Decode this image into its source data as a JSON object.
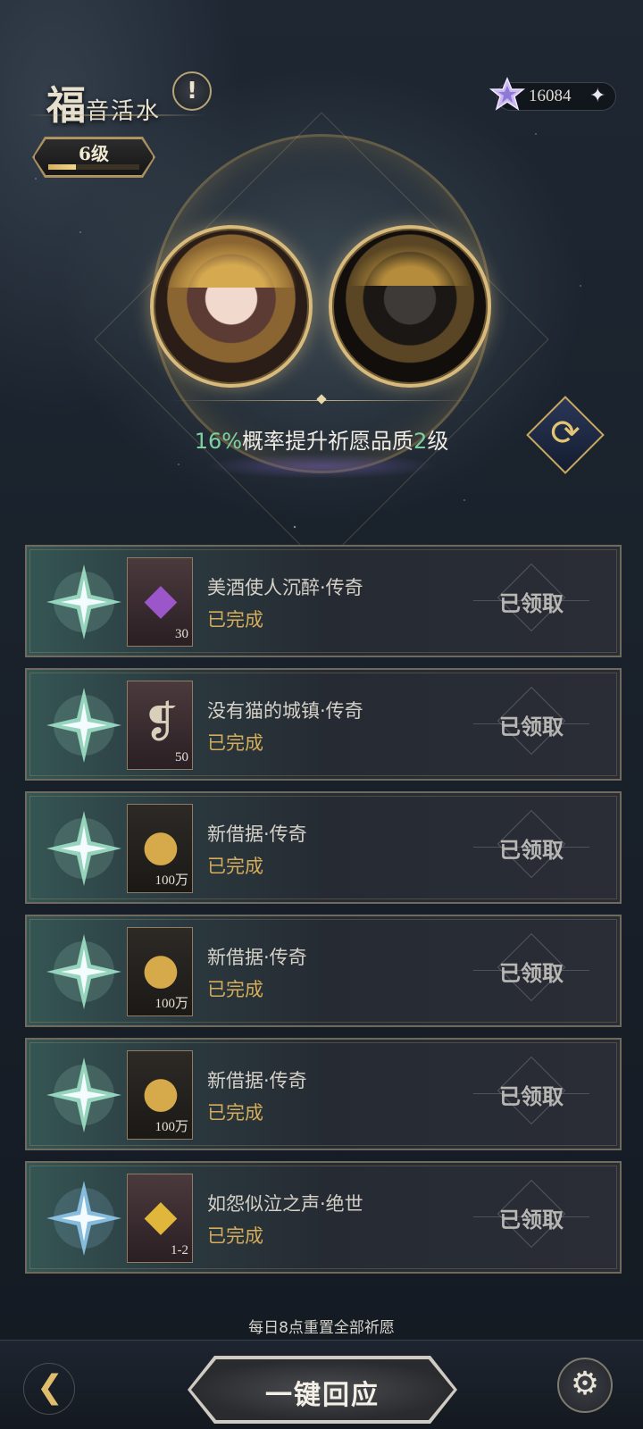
{
  "header": {
    "title_first_char": "福",
    "title_rest": "音活水",
    "info_icon": "exclamation-icon",
    "level_label": "6级",
    "level_progress": 0.3
  },
  "currency": {
    "value": "16084",
    "icon": "star-gem-icon",
    "plus_label": "✦"
  },
  "boost": {
    "percent": "16%",
    "text_middle": "概率提升祈愿品质",
    "level": "2",
    "text_end": "级"
  },
  "tasks": [
    {
      "name": "美酒使人沉醉·传奇",
      "status": "已完成",
      "reward_qty": "30",
      "reward_icon": "purple-crystal-icon",
      "claimed_label": "已领取"
    },
    {
      "name": "没有猫的城镇·传奇",
      "status": "已完成",
      "reward_qty": "50",
      "reward_icon": "scroll-icon",
      "claimed_label": "已领取"
    },
    {
      "name": "新借据·传奇",
      "status": "已完成",
      "reward_qty": "100万",
      "reward_icon": "gold-coin-icon",
      "claimed_label": "已领取"
    },
    {
      "name": "新借据·传奇",
      "status": "已完成",
      "reward_qty": "100万",
      "reward_icon": "gold-coin-icon",
      "claimed_label": "已领取"
    },
    {
      "name": "新借据·传奇",
      "status": "已完成",
      "reward_qty": "100万",
      "reward_icon": "gold-coin-icon",
      "claimed_label": "已领取"
    },
    {
      "name": "如怨似泣之声·绝世",
      "status": "已完成",
      "reward_qty": "1-2",
      "reward_icon": "gold-crystal-icon",
      "claimed_label": "已领取"
    }
  ],
  "reset_note": "每日8点重置全部祈愿",
  "bottom": {
    "main_button_label": "一键回应"
  },
  "colors": {
    "accent_gold": "#d4ac5a",
    "boost_green": "#7fd0a0"
  }
}
